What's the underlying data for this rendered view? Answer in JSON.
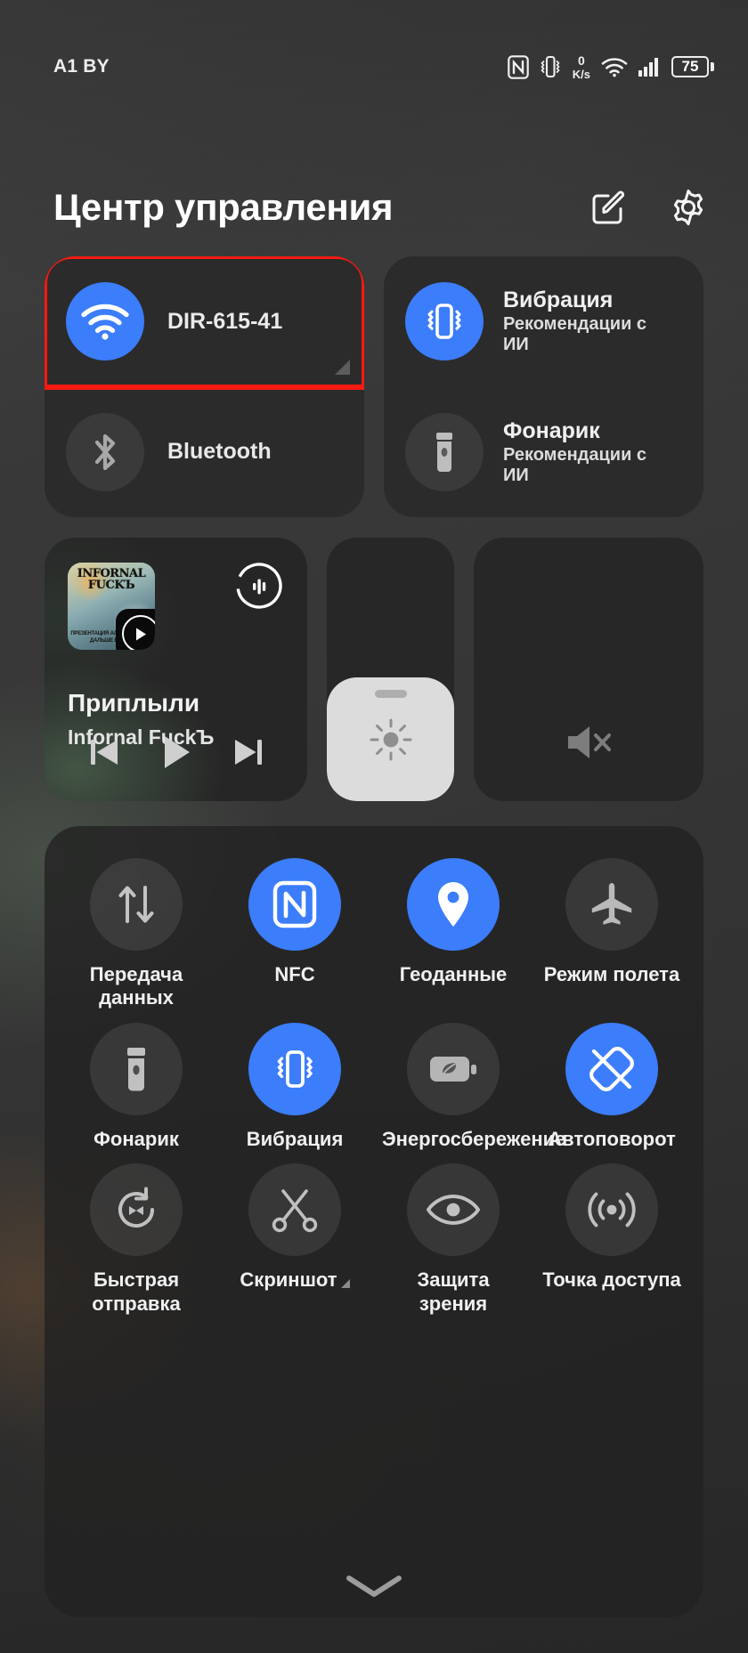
{
  "statusbar": {
    "carrier": "A1 BY",
    "nfc_icon": "nfc-icon",
    "vibrate_icon": "vibration-icon",
    "net_speed_value": "0",
    "net_speed_unit": "K/s",
    "wifi_icon": "wifi-icon",
    "signal_icon": "cellular-signal-icon",
    "battery_level": "75"
  },
  "header": {
    "title": "Центр управления",
    "edit_label": "edit-icon",
    "settings_label": "settings-icon"
  },
  "connectivity": {
    "wifi": {
      "label": "DIR-615-41",
      "state": "on",
      "highlighted": true
    },
    "bluetooth": {
      "label": "Bluetooth",
      "state": "off"
    }
  },
  "recommendations": [
    {
      "title": "Вибрация",
      "subtitle": "Рекомендации с ИИ",
      "state": "on",
      "icon": "vibration-icon"
    },
    {
      "title": "Фонарик",
      "subtitle": "Рекомендации с ИИ",
      "state": "off",
      "icon": "flashlight-icon"
    }
  ],
  "media": {
    "track_title": "Приплыли",
    "artist": "Infornal FuckЪ",
    "album_band": "INFORNAL FUCKЪ",
    "album_caption": "ПРЕЗЕНТАЦИЯ АЛЬБОМА «ЧЕМ ДАЛЬШЕ В ЛЕС»",
    "cast_icon": "cast-audio-icon",
    "prev_label": "previous-track",
    "play_label": "play",
    "next_label": "next-track"
  },
  "brightness": {
    "icon": "brightness-icon",
    "value_percent": 47
  },
  "volume": {
    "icon": "volume-muted-icon",
    "state": "muted"
  },
  "quick_settings": [
    {
      "label": "Передача данных",
      "icon": "data-transfer-icon",
      "state": "off"
    },
    {
      "label": "NFC",
      "icon": "nfc-icon",
      "state": "on"
    },
    {
      "label": "Геоданные",
      "icon": "location-icon",
      "state": "on"
    },
    {
      "label": "Режим полета",
      "icon": "airplane-icon",
      "state": "off"
    },
    {
      "label": "Фонарик",
      "icon": "flashlight-icon",
      "state": "off"
    },
    {
      "label": "Вибрация",
      "icon": "vibration-icon",
      "state": "on"
    },
    {
      "label": "Энергосбережение",
      "icon": "battery-saver-icon",
      "state": "off"
    },
    {
      "label": "Автоповорот",
      "icon": "auto-rotate-icon",
      "state": "on"
    },
    {
      "label": "Быстрая отправка",
      "icon": "quick-share-icon",
      "state": "off"
    },
    {
      "label": "Скриншот",
      "icon": "screenshot-icon",
      "state": "off",
      "has_expander": true
    },
    {
      "label": "Защита зрения",
      "icon": "eye-comfort-icon",
      "state": "off"
    },
    {
      "label": "Точка доступа",
      "icon": "hotspot-icon",
      "state": "off"
    }
  ],
  "colors": {
    "accent_blue": "#3b7dfb",
    "highlight_red": "#f51a12",
    "card_bg": "#2b2b2b",
    "text_primary": "#f0f0f0"
  }
}
